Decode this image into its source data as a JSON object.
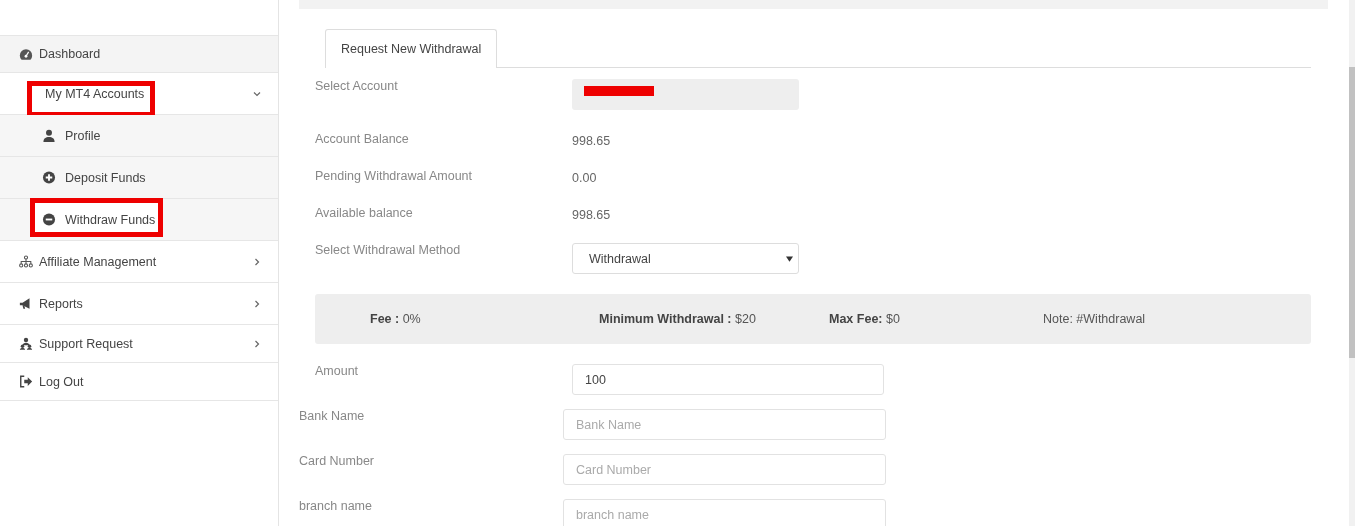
{
  "sidebar": {
    "items": [
      {
        "label": "Dashboard",
        "selected": true,
        "highlighted": false
      },
      {
        "label": "My MT4 Accounts",
        "selected": false,
        "highlighted": true,
        "expanded": true,
        "children": [
          {
            "label": "Profile",
            "highlighted": false
          },
          {
            "label": "Deposit Funds",
            "highlighted": false
          },
          {
            "label": "Withdraw Funds",
            "highlighted": true
          }
        ]
      },
      {
        "label": "Affiliate Management",
        "selected": false,
        "highlighted": false,
        "expanded": false
      },
      {
        "label": "Reports",
        "selected": false,
        "highlighted": false,
        "expanded": false
      },
      {
        "label": "Support Request",
        "selected": false,
        "highlighted": false,
        "expanded": false
      },
      {
        "label": "Log Out",
        "selected": false,
        "highlighted": false
      }
    ]
  },
  "tabs": [
    {
      "label": "Request New Withdrawal",
      "selected": true
    }
  ],
  "form": {
    "rows": [
      {
        "kind": "redacted",
        "label": "Select Account"
      },
      {
        "kind": "text",
        "label": "Account Balance",
        "value": "998.65"
      },
      {
        "kind": "text",
        "label": "Pending Withdrawal Amount",
        "value": "0.00"
      },
      {
        "kind": "text",
        "label": "Available balance",
        "value": "998.65"
      },
      {
        "kind": "select",
        "label": "Select Withdrawal Method",
        "value": "Withdrawal"
      }
    ],
    "info_bar": [
      "**Fee :** 0%",
      "**Minimum Withdrawal :** $20",
      "**Max Fee:** $0",
      "Note: #Withdrawal"
    ],
    "amount": {
      "label": "Amount",
      "value": "100"
    },
    "fields": [
      {
        "label": "Bank Name",
        "placeholder": "Bank Name"
      },
      {
        "label": "Card Number",
        "placeholder": "Card Number"
      },
      {
        "label": "branch name",
        "placeholder": "branch name"
      }
    ]
  }
}
